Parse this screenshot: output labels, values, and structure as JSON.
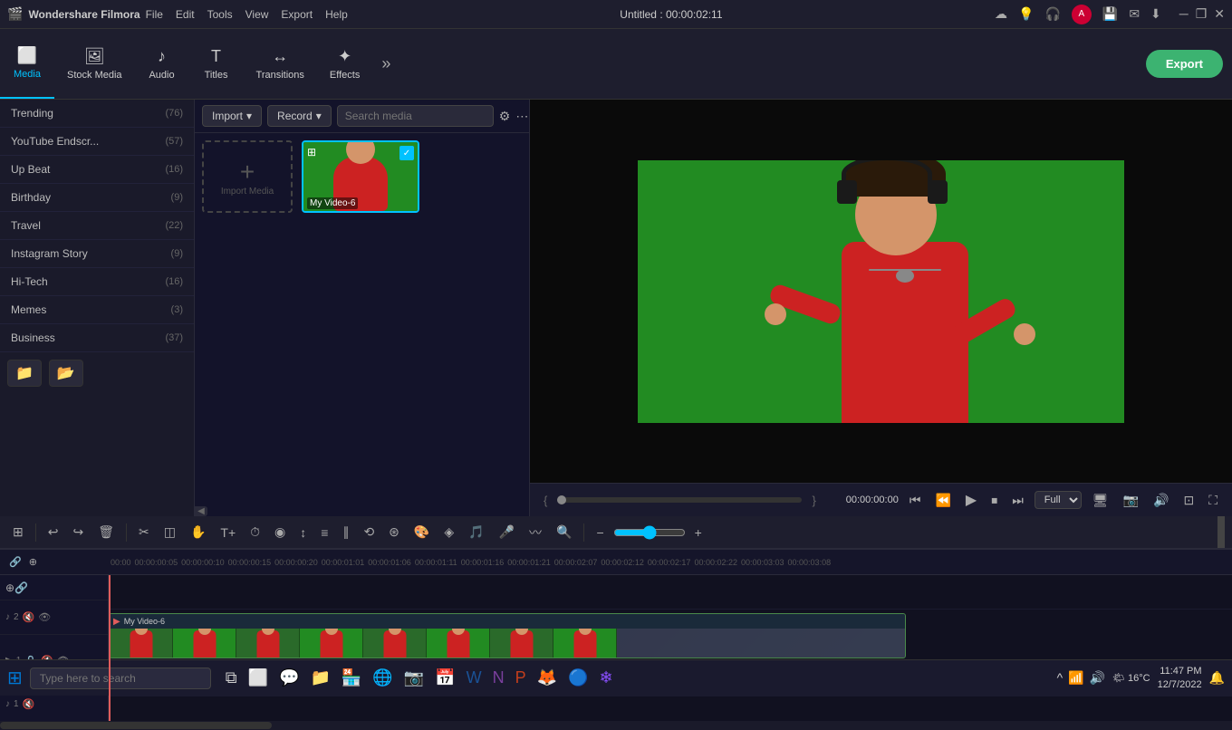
{
  "app": {
    "name": "Wondershare Filmora",
    "title": "Untitled : 00:00:02:11",
    "logo": "🎬"
  },
  "titlebar": {
    "menu_items": [
      "File",
      "Edit",
      "Tools",
      "View",
      "Export",
      "Help"
    ],
    "window_controls": [
      "─",
      "❐",
      "✕"
    ],
    "icons": [
      "cloud-icon",
      "sun-icon",
      "headphone-icon",
      "avatar-icon",
      "save-icon",
      "mail-icon",
      "download-icon"
    ]
  },
  "toolbar": {
    "tabs": [
      {
        "id": "media",
        "label": "Media",
        "icon": "⬜",
        "active": true
      },
      {
        "id": "stock",
        "label": "Stock Media",
        "icon": "🖼"
      },
      {
        "id": "audio",
        "label": "Audio",
        "icon": "♪"
      },
      {
        "id": "titles",
        "label": "Titles",
        "icon": "T"
      },
      {
        "id": "transitions",
        "label": "Transitions",
        "icon": "↔"
      },
      {
        "id": "effects",
        "label": "Effects",
        "icon": "✦"
      }
    ],
    "more_label": "»",
    "export_label": "Export"
  },
  "media_panel": {
    "import_label": "Import",
    "record_label": "Record",
    "search_placeholder": "Search media",
    "items": [
      {
        "id": "my-video-6",
        "name": "My Video-6",
        "selected": true
      }
    ],
    "import_placeholder": "Import Media"
  },
  "sidebar": {
    "items": [
      {
        "name": "Trending",
        "count": "(76)"
      },
      {
        "name": "YouTube Endscr...",
        "count": "(57)"
      },
      {
        "name": "Up Beat",
        "count": "(16)"
      },
      {
        "name": "Birthday",
        "count": "(9)"
      },
      {
        "name": "Travel",
        "count": "(22)"
      },
      {
        "name": "Instagram Story",
        "count": "(9)"
      },
      {
        "name": "Hi-Tech",
        "count": "(16)"
      },
      {
        "name": "Memes",
        "count": "(3)"
      },
      {
        "name": "Business",
        "count": "(37)"
      }
    ],
    "bottom_icons": [
      "📁",
      "📂"
    ]
  },
  "preview": {
    "time_display": "00:00:00:00",
    "total_time": "00:00:02:11",
    "quality": "Full",
    "controls": {
      "prev": "⏮",
      "back": "⏪",
      "play": "▶",
      "stop": "⏹",
      "next": "⏭"
    }
  },
  "edit_toolbar": {
    "tools": [
      "⊞",
      "↩",
      "↪",
      "🗑",
      "✂",
      "◯",
      "⬡",
      "⊕",
      "T",
      "⏱",
      "◉",
      "↕",
      "≡",
      "∥",
      "⟲",
      "⊛",
      "≎",
      "◫",
      "⊠",
      "◈",
      "↯",
      "⊕",
      "−",
      "+"
    ]
  },
  "timeline": {
    "ruler_marks": [
      "00:00",
      "00:00:00:05",
      "00:00:00:10",
      "00:00:00:15",
      "00:00:00:20",
      "00:00:01:01",
      "00:00:01:06",
      "00:00:01:11",
      "00:00:01:16",
      "00:00:01:21",
      "00:00:02:07",
      "00:00:02:12",
      "00:00:02:17",
      "00:00:02:22",
      "00:00:03:03",
      "00:00:03:08"
    ],
    "tracks": [
      {
        "id": "audio2",
        "type": "audio",
        "icon": "♪",
        "num": "2",
        "mute": "🔇",
        "solo": "👁"
      },
      {
        "id": "video1",
        "type": "video",
        "icon": "▶",
        "num": "1",
        "lock": "🔒",
        "mute": "🔇",
        "eye": "👁",
        "clip_name": "My Video-6"
      },
      {
        "id": "audio1",
        "type": "audio",
        "icon": "♪",
        "num": "1",
        "mute": "🔇"
      }
    ]
  },
  "taskbar": {
    "start_icon": "⊞",
    "search_placeholder": "Type here to search",
    "apps": [
      {
        "name": "task-view",
        "icon": "⧉"
      },
      {
        "name": "widgets",
        "icon": "◫"
      },
      {
        "name": "chat",
        "icon": "💬"
      },
      {
        "name": "file-explorer",
        "icon": "📁"
      },
      {
        "name": "store",
        "icon": "🛍"
      },
      {
        "name": "edge",
        "icon": "🌐"
      },
      {
        "name": "instagram",
        "icon": "📷"
      },
      {
        "name": "calendar",
        "icon": "📅"
      },
      {
        "name": "word",
        "icon": "W"
      },
      {
        "name": "onenote",
        "icon": "N"
      },
      {
        "name": "outlook",
        "icon": "O"
      },
      {
        "name": "firefox",
        "icon": "🦊"
      },
      {
        "name": "chrome",
        "icon": "🔵"
      },
      {
        "name": "app1",
        "icon": "❄"
      }
    ],
    "system": {
      "weather": "🌤 16°C",
      "time": "11:47 PM",
      "date": "12/7/2022"
    }
  }
}
